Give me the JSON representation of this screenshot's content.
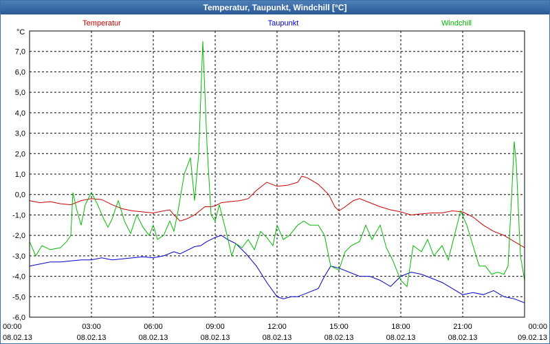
{
  "window": {
    "title": "Temperatur, Taupunkt, Windchill [°C]"
  },
  "chart_data": {
    "type": "line",
    "title": "Temperatur, Taupunkt, Windchill [°C]",
    "ylabel": "°C",
    "ylim": [
      -6,
      8
    ],
    "xlim": [
      0,
      24
    ],
    "grid": true,
    "legend": "top",
    "yticks": [
      "7,0",
      "6,0",
      "5,0",
      "4,0",
      "3,0",
      "2,0",
      "1,0",
      "0,0",
      "-1,0",
      "-2,0",
      "-3,0",
      "-4,0",
      "-5,0",
      "-6,0"
    ],
    "ytick_values": [
      7,
      6,
      5,
      4,
      3,
      2,
      1,
      0,
      -1,
      -2,
      -3,
      -4,
      -5,
      -6
    ],
    "xticks": [
      {
        "time": "00:00",
        "date": "08.02.13"
      },
      {
        "time": "03:00",
        "date": "08.02.13"
      },
      {
        "time": "06:00",
        "date": "08.02.13"
      },
      {
        "time": "09:00",
        "date": "08.02.13"
      },
      {
        "time": "12:00",
        "date": "08.02.13"
      },
      {
        "time": "15:00",
        "date": "08.02.13"
      },
      {
        "time": "18:00",
        "date": "08.02.13"
      },
      {
        "time": "21:00",
        "date": "08.02.13"
      },
      {
        "time": "00:00",
        "date": "09.02.13"
      }
    ],
    "series": [
      {
        "name": "Temperatur",
        "color": "#cc0000",
        "points": [
          [
            0,
            -0.3
          ],
          [
            0.5,
            -0.4
          ],
          [
            1.0,
            -0.35
          ],
          [
            1.5,
            -0.45
          ],
          [
            2.0,
            -0.5
          ],
          [
            2.5,
            -0.3
          ],
          [
            3.0,
            -0.2
          ],
          [
            3.5,
            -0.25
          ],
          [
            4.0,
            -0.5
          ],
          [
            4.5,
            -0.7
          ],
          [
            5.0,
            -0.8
          ],
          [
            5.5,
            -0.85
          ],
          [
            6.0,
            -0.9
          ],
          [
            6.5,
            -0.8
          ],
          [
            6.8,
            -0.75
          ],
          [
            7.0,
            -1.0
          ],
          [
            7.3,
            -1.3
          ],
          [
            7.6,
            -1.2
          ],
          [
            8.0,
            -1.0
          ],
          [
            8.5,
            -0.6
          ],
          [
            8.8,
            -0.6
          ],
          [
            9.0,
            -0.55
          ],
          [
            9.3,
            -0.4
          ],
          [
            9.7,
            -0.35
          ],
          [
            10.2,
            -0.3
          ],
          [
            10.6,
            -0.2
          ],
          [
            11.0,
            0.2
          ],
          [
            11.5,
            0.6
          ],
          [
            12.0,
            0.4
          ],
          [
            12.5,
            0.45
          ],
          [
            13.0,
            0.6
          ],
          [
            13.2,
            0.9
          ],
          [
            13.5,
            0.8
          ],
          [
            14.0,
            0.5
          ],
          [
            14.5,
            0.0
          ],
          [
            14.8,
            -0.6
          ],
          [
            15.0,
            -0.8
          ],
          [
            15.3,
            -0.6
          ],
          [
            15.7,
            -0.3
          ],
          [
            16.0,
            -0.2
          ],
          [
            16.5,
            -0.4
          ],
          [
            17.0,
            -0.6
          ],
          [
            17.5,
            -0.75
          ],
          [
            18.0,
            -0.85
          ],
          [
            18.5,
            -1.0
          ],
          [
            19.0,
            -0.95
          ],
          [
            19.5,
            -0.9
          ],
          [
            20.0,
            -0.9
          ],
          [
            20.5,
            -0.8
          ],
          [
            21.0,
            -0.85
          ],
          [
            21.5,
            -1.1
          ],
          [
            22.0,
            -1.5
          ],
          [
            22.5,
            -1.8
          ],
          [
            23.0,
            -2.0
          ],
          [
            23.5,
            -2.3
          ],
          [
            24.0,
            -2.6
          ]
        ]
      },
      {
        "name": "Taupunkt",
        "color": "#0000cc",
        "points": [
          [
            0,
            -3.5
          ],
          [
            0.5,
            -3.4
          ],
          [
            1.0,
            -3.3
          ],
          [
            1.5,
            -3.3
          ],
          [
            2.0,
            -3.25
          ],
          [
            2.5,
            -3.2
          ],
          [
            3.0,
            -3.2
          ],
          [
            3.5,
            -3.1
          ],
          [
            4.0,
            -3.2
          ],
          [
            4.5,
            -3.15
          ],
          [
            5.0,
            -3.1
          ],
          [
            5.5,
            -3.05
          ],
          [
            6.0,
            -3.1
          ],
          [
            6.5,
            -3.0
          ],
          [
            7.0,
            -2.8
          ],
          [
            7.3,
            -2.9
          ],
          [
            7.6,
            -2.75
          ],
          [
            8.0,
            -2.55
          ],
          [
            8.3,
            -2.5
          ],
          [
            8.6,
            -2.3
          ],
          [
            9.0,
            -2.1
          ],
          [
            9.3,
            -2.0
          ],
          [
            9.6,
            -2.2
          ],
          [
            10.0,
            -2.4
          ],
          [
            10.5,
            -2.9
          ],
          [
            11.0,
            -3.5
          ],
          [
            11.5,
            -4.3
          ],
          [
            12.0,
            -5.0
          ],
          [
            12.3,
            -5.1
          ],
          [
            12.7,
            -5.0
          ],
          [
            13.0,
            -5.0
          ],
          [
            13.5,
            -4.8
          ],
          [
            14.0,
            -4.6
          ],
          [
            14.3,
            -4.0
          ],
          [
            14.6,
            -3.5
          ],
          [
            15.0,
            -3.6
          ],
          [
            15.5,
            -3.8
          ],
          [
            16.0,
            -4.0
          ],
          [
            16.5,
            -4.0
          ],
          [
            17.0,
            -4.2
          ],
          [
            17.5,
            -4.5
          ],
          [
            18.0,
            -4.0
          ],
          [
            18.5,
            -3.8
          ],
          [
            19.0,
            -3.9
          ],
          [
            19.5,
            -4.1
          ],
          [
            20.0,
            -4.3
          ],
          [
            20.5,
            -4.6
          ],
          [
            21.0,
            -4.9
          ],
          [
            21.5,
            -4.8
          ],
          [
            22.0,
            -4.9
          ],
          [
            22.5,
            -4.7
          ],
          [
            23.0,
            -5.0
          ],
          [
            23.5,
            -5.1
          ],
          [
            24.0,
            -5.3
          ]
        ]
      },
      {
        "name": "Windchill",
        "color": "#00bb00",
        "points": [
          [
            0,
            -2.3
          ],
          [
            0.3,
            -3.0
          ],
          [
            0.6,
            -2.5
          ],
          [
            1.0,
            -2.7
          ],
          [
            1.5,
            -2.6
          ],
          [
            1.8,
            -2.3
          ],
          [
            2.0,
            -2.0
          ],
          [
            2.1,
            0.1
          ],
          [
            2.3,
            -0.8
          ],
          [
            2.5,
            -1.5
          ],
          [
            2.7,
            -0.5
          ],
          [
            3.0,
            0.1
          ],
          [
            3.3,
            -0.5
          ],
          [
            3.6,
            -1.2
          ],
          [
            3.8,
            -1.6
          ],
          [
            4.0,
            -1.2
          ],
          [
            4.3,
            -0.3
          ],
          [
            4.6,
            -1.3
          ],
          [
            4.9,
            -1.9
          ],
          [
            5.2,
            -1.0
          ],
          [
            5.5,
            -1.6
          ],
          [
            5.8,
            -2.0
          ],
          [
            6.0,
            -1.5
          ],
          [
            6.2,
            -2.2
          ],
          [
            6.5,
            -2.0
          ],
          [
            6.8,
            -1.3
          ],
          [
            7.0,
            -1.8
          ],
          [
            7.2,
            -0.8
          ],
          [
            7.5,
            1.0
          ],
          [
            7.8,
            1.8
          ],
          [
            8.0,
            -0.3
          ],
          [
            8.2,
            2.0
          ],
          [
            8.4,
            7.5
          ],
          [
            8.6,
            2.5
          ],
          [
            8.8,
            -1.0
          ],
          [
            9.0,
            -1.3
          ],
          [
            9.2,
            -0.5
          ],
          [
            9.4,
            -1.3
          ],
          [
            9.6,
            -2.1
          ],
          [
            9.8,
            -3.0
          ],
          [
            10.0,
            -2.4
          ],
          [
            10.3,
            -2.6
          ],
          [
            10.6,
            -2.2
          ],
          [
            10.9,
            -2.7
          ],
          [
            11.2,
            -1.8
          ],
          [
            11.5,
            -2.1
          ],
          [
            11.8,
            -2.5
          ],
          [
            12.0,
            -1.5
          ],
          [
            12.3,
            -2.2
          ],
          [
            12.6,
            -2.0
          ],
          [
            13.0,
            -1.5
          ],
          [
            13.3,
            -1.3
          ],
          [
            13.6,
            -1.5
          ],
          [
            14.0,
            -1.5
          ],
          [
            14.3,
            -2.0
          ],
          [
            14.6,
            -3.5
          ],
          [
            15.0,
            -3.7
          ],
          [
            15.3,
            -2.8
          ],
          [
            15.6,
            -2.5
          ],
          [
            16.0,
            -2.3
          ],
          [
            16.3,
            -1.5
          ],
          [
            16.6,
            -2.2
          ],
          [
            17.0,
            -1.5
          ],
          [
            17.3,
            -2.6
          ],
          [
            17.6,
            -3.2
          ],
          [
            18.0,
            -4.2
          ],
          [
            18.3,
            -4.5
          ],
          [
            18.6,
            -2.5
          ],
          [
            19.0,
            -2.8
          ],
          [
            19.3,
            -2.2
          ],
          [
            19.6,
            -3.0
          ],
          [
            20.0,
            -2.5
          ],
          [
            20.3,
            -3.2
          ],
          [
            20.6,
            -2.0
          ],
          [
            20.9,
            -0.8
          ],
          [
            21.2,
            -1.5
          ],
          [
            21.5,
            -2.5
          ],
          [
            21.8,
            -3.5
          ],
          [
            22.1,
            -3.5
          ],
          [
            22.4,
            -3.9
          ],
          [
            22.7,
            -3.8
          ],
          [
            23.0,
            -3.9
          ],
          [
            23.2,
            -3.5
          ],
          [
            23.4,
            0.5
          ],
          [
            23.5,
            2.6
          ],
          [
            23.6,
            1.5
          ],
          [
            23.8,
            -3.0
          ],
          [
            24.0,
            -4.2
          ]
        ]
      }
    ]
  }
}
